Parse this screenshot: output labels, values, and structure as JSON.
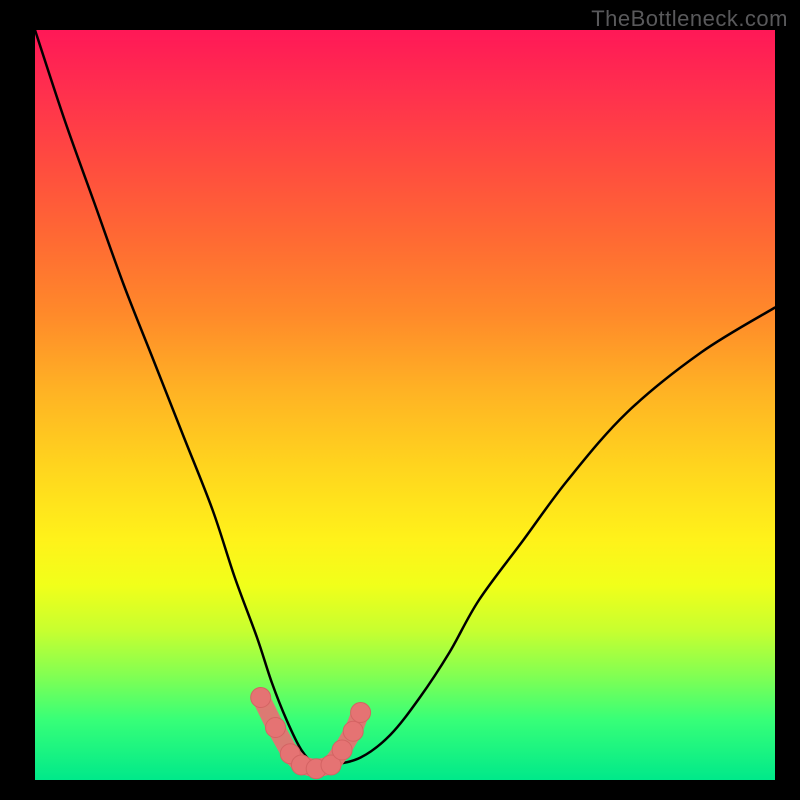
{
  "watermark": "TheBottleneck.com",
  "colors": {
    "frame": "#000000",
    "curve": "#000000",
    "marker_fill": "#e57373",
    "marker_stroke": "#d46363",
    "green_line": "#00e676"
  },
  "chart_data": {
    "type": "line",
    "title": "",
    "xlabel": "",
    "ylabel": "",
    "xlim": [
      0,
      100
    ],
    "ylim": [
      0,
      100
    ],
    "series": [
      {
        "name": "bottleneck-curve",
        "x": [
          0,
          4,
          8,
          12,
          16,
          20,
          24,
          27,
          30,
          32,
          34,
          36,
          38,
          40,
          44,
          48,
          52,
          56,
          60,
          66,
          72,
          80,
          90,
          100
        ],
        "y": [
          100,
          88,
          77,
          66,
          56,
          46,
          36,
          27,
          19,
          13,
          8,
          4,
          2,
          2,
          3,
          6,
          11,
          17,
          24,
          32,
          40,
          49,
          57,
          63
        ]
      }
    ],
    "markers": {
      "name": "highlighted-points",
      "x": [
        30.5,
        32.5,
        34.5,
        36.0,
        38.0,
        40.0,
        41.5,
        43.0,
        44.0
      ],
      "y": [
        11.0,
        7.0,
        3.5,
        2.0,
        1.5,
        2.0,
        4.0,
        6.5,
        9.0
      ]
    },
    "baseline": {
      "y": 0.5
    }
  }
}
